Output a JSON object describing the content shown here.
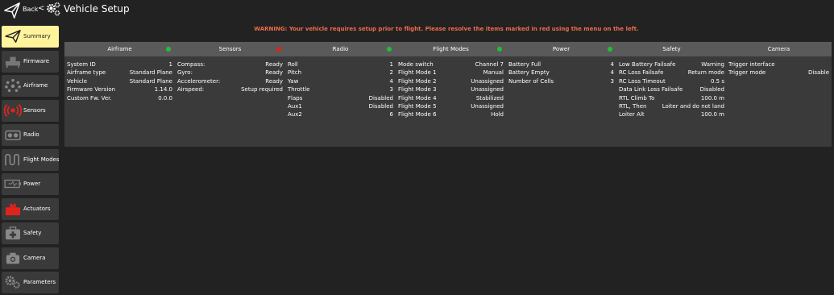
{
  "header": {
    "back_label": "Back",
    "separator": "<",
    "title": "Vehicle Setup"
  },
  "warning": "WARNING: Your vehicle requires setup prior to flight. Please resolve the items marked in red using the menu on the left.",
  "colors": {
    "ok": "#1fbf3a",
    "error": "#e0241c",
    "active": "#fff39c",
    "warning": "#ef6b4b"
  },
  "sidebar": {
    "items": [
      {
        "label": "Summary",
        "icon": "paper-plane-icon",
        "active": true
      },
      {
        "label": "Firmware",
        "icon": "firmware-icon"
      },
      {
        "label": "Airframe",
        "icon": "airframe-icon"
      },
      {
        "label": "Sensors",
        "icon": "sensors-icon",
        "error": true
      },
      {
        "label": "Radio",
        "icon": "radio-icon"
      },
      {
        "label": "Flight Modes",
        "icon": "flight-modes-icon"
      },
      {
        "label": "Power",
        "icon": "battery-icon"
      },
      {
        "label": "Actuators",
        "icon": "actuators-icon",
        "error": true
      },
      {
        "label": "Safety",
        "icon": "first-aid-icon"
      },
      {
        "label": "Camera",
        "icon": "camera-icon"
      },
      {
        "label": "Parameters",
        "icon": "parameters-gear-icon"
      }
    ]
  },
  "cards": [
    {
      "title": "Airframe",
      "status": "ok",
      "rows": [
        [
          "System ID",
          "1"
        ],
        [
          "Airframe type",
          "Standard Plane"
        ],
        [
          "Vehicle",
          "Standard Plane"
        ],
        [
          "Firmware Version",
          "1.14.0"
        ],
        [
          "Custom Fw. Ver.",
          "0.0.0"
        ]
      ]
    },
    {
      "title": "Sensors",
      "status": "error",
      "rows": [
        [
          "Compass:",
          "Ready"
        ],
        [
          "Gyro:",
          "Ready"
        ],
        [
          "Accelerometer:",
          "Ready"
        ],
        [
          "Airspeed:",
          "Setup required"
        ]
      ]
    },
    {
      "title": "Radio",
      "status": "ok",
      "rows": [
        [
          "Roll",
          "1"
        ],
        [
          "Pitch",
          "2"
        ],
        [
          "Yaw",
          "4"
        ],
        [
          "Throttle",
          "3"
        ],
        [
          "Flaps",
          "Disabled"
        ],
        [
          "Aux1",
          "Disabled"
        ],
        [
          "Aux2",
          "6"
        ]
      ]
    },
    {
      "title": "Flight Modes",
      "status": "ok",
      "rows": [
        [
          "Mode switch",
          "Channel 7"
        ],
        [
          "Flight Mode 1",
          "Manual"
        ],
        [
          "Flight Mode 2",
          "Unassigned"
        ],
        [
          "Flight Mode 3",
          "Unassigned"
        ],
        [
          "Flight Mode 4",
          "Stabilized"
        ],
        [
          "Flight Mode 5",
          "Unassigned"
        ],
        [
          "Flight Mode 6",
          "Hold"
        ]
      ]
    },
    {
      "title": "Power",
      "status": "ok",
      "rows": [
        [
          "Battery Full",
          "4"
        ],
        [
          "Battery Empty",
          "4"
        ],
        [
          "Number of Cells",
          "3"
        ]
      ]
    },
    {
      "title": "Safety",
      "status": "none",
      "rows": [
        [
          "Low Battery Failsafe",
          "Warning"
        ],
        [
          "RC Loss Failsafe",
          "Return mode"
        ],
        [
          "RC Loss Timeout",
          "0.5 s"
        ],
        [
          "Data Link Loss Failsafe",
          "Disabled"
        ],
        [
          "RTL Climb To",
          "100.0 m"
        ],
        [
          "RTL, Then",
          "Loiter and do not land"
        ],
        [
          "Loiter Alt",
          "100.0 m"
        ]
      ]
    },
    {
      "title": "Camera",
      "status": "none",
      "rows": [
        [
          "Trigger interface",
          ""
        ],
        [
          "Trigger mode",
          "Disable"
        ]
      ]
    }
  ]
}
